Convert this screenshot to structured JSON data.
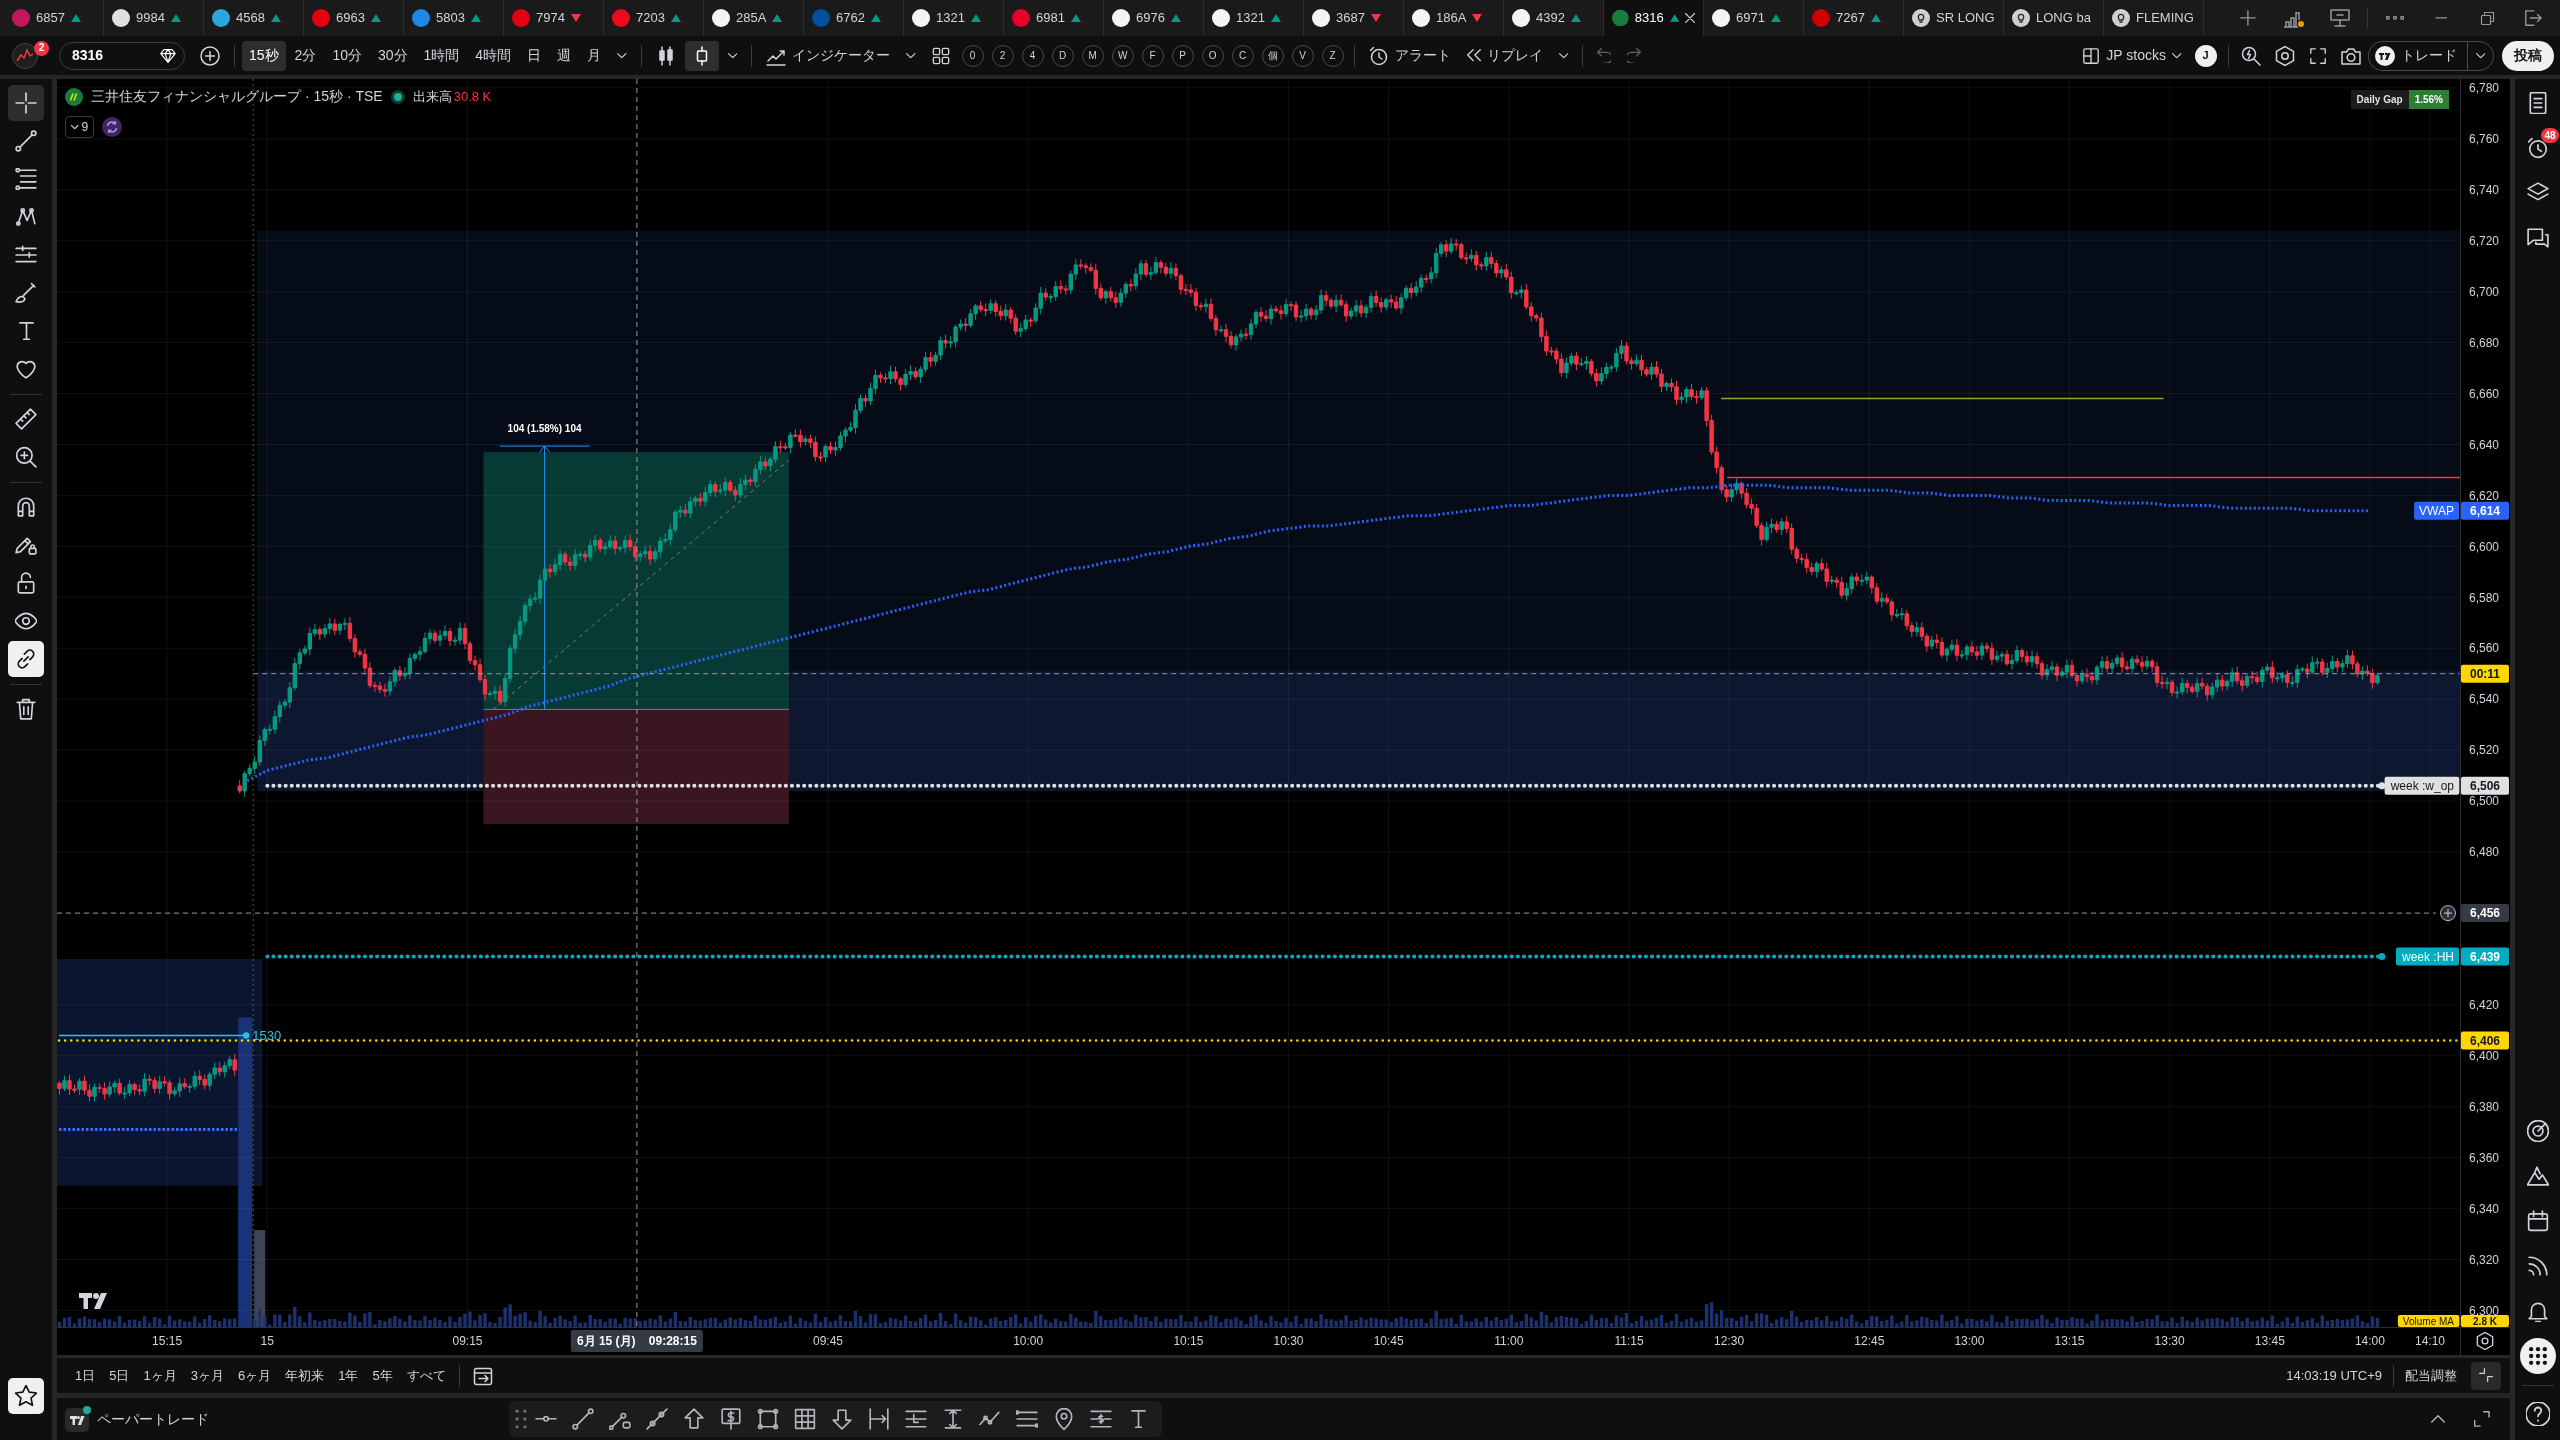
{
  "tabs": [
    {
      "label": "6857",
      "kind": "symbol",
      "rising": true,
      "color": "#c2185b",
      "selected": false
    },
    {
      "label": "9984",
      "kind": "symbol",
      "rising": true,
      "color": "#e0e0e0",
      "selected": false
    },
    {
      "label": "4568",
      "kind": "symbol",
      "rising": true,
      "color": "#29a8e0",
      "selected": false
    },
    {
      "label": "6963",
      "kind": "symbol",
      "rising": true,
      "color": "#e60012",
      "selected": false
    },
    {
      "label": "5803",
      "kind": "symbol",
      "rising": true,
      "color": "#1e88e5",
      "selected": false
    },
    {
      "label": "7974",
      "kind": "symbol",
      "rising": false,
      "color": "#e60012",
      "selected": false
    },
    {
      "label": "7203",
      "kind": "symbol",
      "rising": true,
      "color": "#eb0a1e",
      "selected": false
    },
    {
      "label": "285A",
      "kind": "symbol",
      "rising": true,
      "color": "#f5f5f5",
      "selected": false
    },
    {
      "label": "6762",
      "kind": "symbol",
      "rising": true,
      "color": "#0050a0",
      "selected": false
    },
    {
      "label": "1321",
      "kind": "symbol",
      "rising": true,
      "color": "#f5f5f5",
      "selected": false
    },
    {
      "label": "6981",
      "kind": "symbol",
      "rising": true,
      "color": "#e4002b",
      "selected": false
    },
    {
      "label": "6976",
      "kind": "symbol",
      "rising": true,
      "color": "#f5f5f5",
      "selected": false
    },
    {
      "label": "1321",
      "kind": "symbol",
      "rising": true,
      "color": "#f5f5f5",
      "selected": false
    },
    {
      "label": "3687",
      "kind": "symbol",
      "rising": false,
      "color": "#f5f5f5",
      "selected": false
    },
    {
      "label": "186A",
      "kind": "symbol",
      "rising": false,
      "color": "#f5f5f5",
      "selected": false
    },
    {
      "label": "4392",
      "kind": "symbol",
      "rising": true,
      "color": "#f5f5f5",
      "selected": false
    },
    {
      "label": "8316",
      "kind": "symbol",
      "rising": true,
      "color": "#1b7a3e",
      "selected": true
    },
    {
      "label": "6971",
      "kind": "symbol",
      "rising": true,
      "color": "#f5f5f5",
      "selected": false
    },
    {
      "label": "7267",
      "kind": "symbol",
      "rising": true,
      "color": "#cc0000",
      "selected": false
    },
    {
      "label": "SR LONG",
      "kind": "layout",
      "color": "#d0d0d0",
      "selected": false
    },
    {
      "label": "LONG ba",
      "kind": "layout",
      "color": "#d0d0d0",
      "selected": false
    },
    {
      "label": "FLEMING",
      "kind": "layout",
      "color": "#d0d0d0",
      "selected": false
    }
  ],
  "toolbar": {
    "notification_count": "2",
    "symbol": "8316",
    "intervals": [
      {
        "label": "15秒",
        "selected": true
      },
      {
        "label": "2分",
        "selected": false
      },
      {
        "label": "10分",
        "selected": false
      },
      {
        "label": "30分",
        "selected": false
      },
      {
        "label": "1時間",
        "selected": false
      },
      {
        "label": "4時間",
        "selected": false
      },
      {
        "label": "日",
        "selected": false
      },
      {
        "label": "週",
        "selected": false
      },
      {
        "label": "月",
        "selected": false
      }
    ],
    "chart_styles": [
      {
        "kind": "candles",
        "selected": false
      },
      {
        "kind": "hollow",
        "selected": true
      }
    ],
    "indicators": "インジケーター",
    "quick_buttons": [
      "0",
      "2",
      "4",
      "D",
      "M",
      "W",
      "F",
      "P",
      "O",
      "C",
      "個",
      "V",
      "Z"
    ],
    "alert": "アラート",
    "replay": "リプレイ",
    "layout": "JP stocks",
    "user_initial": "J",
    "trade": "トレード",
    "publish": "投稿"
  },
  "drawing_tools": [
    [
      {
        "kind": "crosshair",
        "selected": true
      },
      {
        "kind": "trendline",
        "selected": false
      },
      {
        "kind": "fib",
        "selected": false
      },
      {
        "kind": "pattern",
        "selected": false
      },
      {
        "kind": "projection",
        "selected": false
      },
      {
        "kind": "brush",
        "selected": false
      },
      {
        "kind": "text",
        "selected": false
      },
      {
        "kind": "heart",
        "selected": false
      }
    ],
    [
      {
        "kind": "ruler",
        "selected": false
      },
      {
        "kind": "zoom",
        "selected": false
      }
    ],
    [
      {
        "kind": "magnet",
        "on": false
      },
      {
        "kind": "lock_drawing",
        "on": false
      },
      {
        "kind": "lock",
        "on": false
      },
      {
        "kind": "eye",
        "on": false
      },
      {
        "kind": "sync",
        "on": true
      }
    ],
    [
      {
        "kind": "trash"
      }
    ]
  ],
  "favorites_toolbar": {
    "on": true
  },
  "chart": {
    "title": "三井住友フィナンシャルグループ · 15秒 · TSE",
    "volume_label": "出来高",
    "volume_value": "30.8 K",
    "indicators_count": "9",
    "daily_gap": {
      "label": "Daily Gap",
      "value": "1.56%"
    },
    "position_label": "104 (1.58%) 104",
    "vwap_price": "6,614",
    "levels": [
      {
        "kind": "level",
        "label": "week :w_op",
        "price": "6,506",
        "color": "#e0e0e0"
      },
      {
        "kind": "level",
        "label": "week :HH",
        "price": "6,439",
        "color": "#00acc1"
      },
      {
        "kind": "marker",
        "label": "1530",
        "color": "#26c6da"
      },
      {
        "kind": "price_line",
        "price": "6,406",
        "color": "#ffd600"
      }
    ],
    "countdown": "00:11",
    "crosshair": {
      "price": "6,456",
      "date": "6月 15 (月)",
      "time": "09:28:15"
    },
    "volume_ma": {
      "label": "Volume MA",
      "value": "2.8 K"
    },
    "chart_data": {
      "type": "line",
      "categories": [
        null,
        null,
        null,
        null,
        null,
        "15:15",
        null,
        null,
        null,
        null,
        "15",
        null,
        null,
        null,
        null,
        null,
        null,
        null,
        null,
        null,
        "09:15",
        null,
        null,
        null,
        null,
        null,
        null,
        null,
        null,
        null,
        null,
        null,
        null,
        null,
        null,
        null,
        null,
        null,
        "09:45",
        null,
        null,
        null,
        null,
        null,
        null,
        null,
        null,
        null,
        "10:00",
        null,
        null,
        null,
        null,
        null,
        null,
        null,
        "10:15",
        null,
        null,
        null,
        null,
        "10:30",
        null,
        null,
        null,
        null,
        "10:45",
        null,
        null,
        null,
        null,
        null,
        "11:00",
        null,
        null,
        null,
        null,
        null,
        "11:15",
        null,
        null,
        null,
        null,
        "12:30",
        null,
        null,
        null,
        null,
        null,
        null,
        "12:45",
        null,
        null,
        null,
        null,
        "13:00",
        null,
        null,
        null,
        null,
        "13:15",
        null,
        null,
        null,
        null,
        "13:30",
        null,
        null,
        null,
        null,
        "13:45",
        null,
        null,
        null,
        null,
        "14:00",
        null,
        null,
        "14:10",
        null
      ],
      "ylim": [
        6293.5,
        6783.5
      ],
      "yticks": [
        {
          "value": 6300,
          "label": "6,300"
        },
        {
          "value": 6320,
          "label": "6,320"
        },
        {
          "value": 6340,
          "label": "6,340"
        },
        {
          "value": 6360,
          "label": "6,360"
        },
        {
          "value": 6380,
          "label": "6,380"
        },
        {
          "value": 6400,
          "label": "6,400"
        },
        {
          "value": 6420,
          "label": "6,420"
        },
        {
          "value": 6480,
          "label": "6,480"
        },
        {
          "value": 6500,
          "label": "6,500"
        },
        {
          "value": 6520,
          "label": "6,520"
        },
        {
          "value": 6540,
          "label": "6,540"
        },
        {
          "value": 6560,
          "label": "6,560"
        },
        {
          "value": 6580,
          "label": "6,580"
        },
        {
          "value": 6600,
          "label": "6,600"
        },
        {
          "value": 6620,
          "label": "6,620"
        },
        {
          "value": 6640,
          "label": "6,640"
        },
        {
          "value": 6660,
          "label": "6,660"
        },
        {
          "value": 6680,
          "label": "6,680"
        },
        {
          "value": 6700,
          "label": "6,700"
        },
        {
          "value": 6720,
          "label": "6,720"
        },
        {
          "value": 6740,
          "label": "6,740"
        },
        {
          "value": 6760,
          "label": "6,760"
        },
        {
          "value": 6780,
          "label": "6,780"
        }
      ],
      "grid": true,
      "series": [
        {
          "name": "VWAP",
          "color": "#2962ff",
          "line_style": "dotted",
          "values": [
            null,
            null,
            null,
            null,
            null,
            null,
            null,
            null,
            null,
            6508,
            6512,
            6514,
            6516,
            6517,
            6519,
            6521,
            6523,
            6525,
            6526,
            6528,
            6530,
            6532,
            6534,
            6537,
            6539,
            6541,
            6543,
            6545,
            6548,
            6550,
            6552,
            6554,
            6556,
            6558,
            6560,
            6562,
            6564,
            6566,
            6568,
            6570,
            6572,
            6574,
            6576,
            6578,
            6580,
            6582,
            6583,
            6585,
            6587,
            6589,
            6591,
            6592,
            6594,
            6595,
            6597,
            6598,
            6600,
            6601,
            6603,
            6604,
            6606,
            6607,
            6608,
            6608,
            6609,
            6610,
            6611,
            6612,
            6612,
            6613,
            6614,
            6615,
            6616,
            6616,
            6617,
            6618,
            6619,
            6620,
            6620,
            6621,
            6622,
            6623,
            6623,
            6624,
            6624,
            6624,
            6623,
            6623,
            6623,
            6622,
            6622,
            6622,
            6621,
            6621,
            6620,
            6620,
            6620,
            6619,
            6619,
            6618,
            6618,
            6618,
            6617,
            6617,
            6617,
            6616,
            6616,
            6616,
            6615,
            6615,
            6615,
            6615,
            6614,
            6614,
            6614,
            6614,
            null,
            null,
            null,
            null
          ]
        }
      ]
    }
  },
  "range_bar": {
    "ranges": [
      "1日",
      "5日",
      "1ヶ月",
      "3ヶ月",
      "6ヶ月",
      "年初来",
      "1年",
      "5年",
      "すべて"
    ],
    "clock": "14:03:19 UTC+9",
    "adjust": "配当調整"
  },
  "bottom_panel": {
    "title": "ペーパートレード"
  },
  "sidebar": {
    "alerts_badge": "48"
  }
}
